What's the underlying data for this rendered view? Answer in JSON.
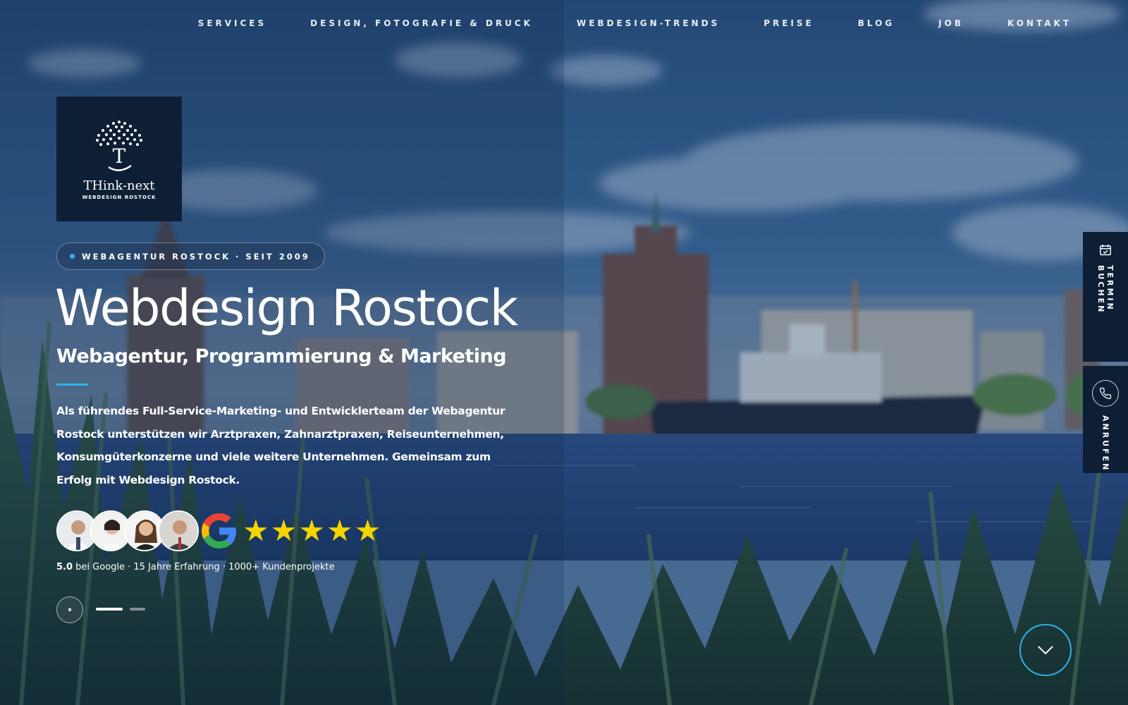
{
  "nav": {
    "items": [
      "SERVICES",
      "DESIGN, FOTOGRAFIE & DRUCK",
      "WEBDESIGN-TRENDS",
      "PREISE",
      "BLOG",
      "JOB",
      "KONTAKT"
    ]
  },
  "logo": {
    "name": "THink-next",
    "subline": "WEBDESIGN ROSTOCK"
  },
  "hero": {
    "badge": "WEBAGENTUR ROSTOCK · SEIT 2009",
    "title": "Webdesign Rostock",
    "subtitle": "Webagentur, Programmierung & Marketing",
    "description": "Als führendes Full-Service-Marketing- und Entwicklerteam der Webagentur Rostock unterstützen wir Arztpraxen, Zahnarztpraxen, Reiseunternehmen, Konsumgüterkonzerne und viele weitere Unternehmen. Gemeinsam zum Erfolg mit Webdesign Rostock."
  },
  "reviews": {
    "rating": "5.0",
    "summary": "bei Google · 15 Jahre Erfahrung · 1000+ Kundenprojekte",
    "stars": 5
  },
  "slider": {
    "pause_icon": "pause-icon",
    "pause_glyph": "⏸",
    "active_index": 0,
    "count": 2
  },
  "side": {
    "termin_label": "TERMIN BUCHEN",
    "anrufen_label": "ANRUFEN"
  },
  "colors": {
    "accent": "#2cb4ea",
    "panel": "#0e1f35",
    "star": "#f5d400"
  }
}
